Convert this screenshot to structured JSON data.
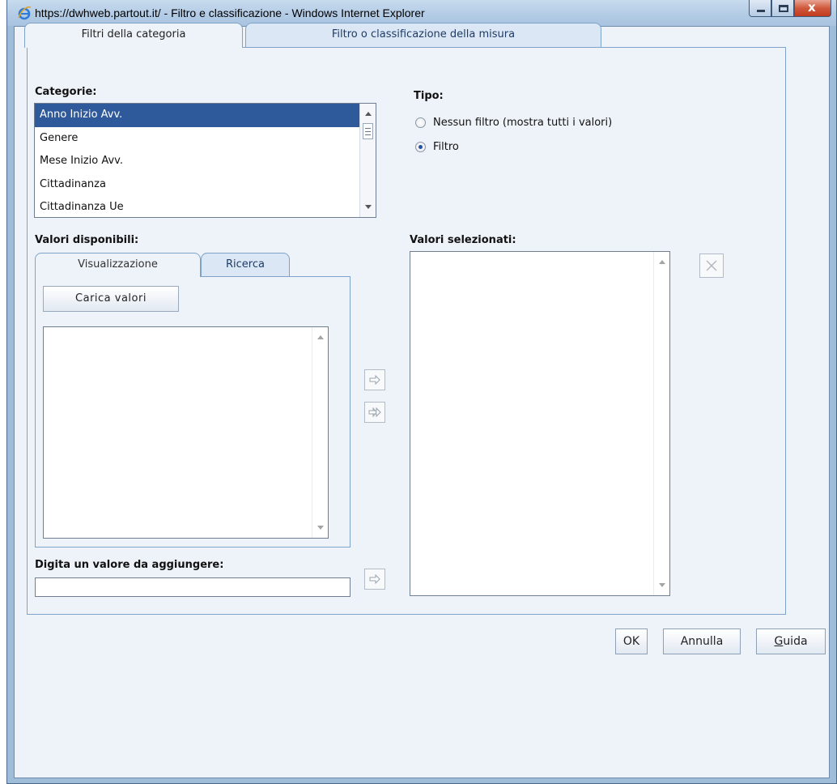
{
  "window": {
    "title": "https://dwhweb.partout.it/ - Filtro e classificazione - Windows Internet Explorer",
    "close_glyph": "x"
  },
  "tabs": [
    {
      "label": "Filtri della categoria",
      "active": true
    },
    {
      "label": "Filtro o classificazione della misura",
      "active": false
    }
  ],
  "categories": {
    "label": "Categorie:",
    "items": [
      {
        "label": "Anno Inizio Avv.",
        "selected": true
      },
      {
        "label": "Genere",
        "selected": false
      },
      {
        "label": "Mese Inizio Avv.",
        "selected": false
      },
      {
        "label": "Cittadinanza",
        "selected": false
      },
      {
        "label": "Cittadinanza Ue",
        "selected": false
      }
    ]
  },
  "type": {
    "label": "Tipo:",
    "options": [
      {
        "label": "Nessun filtro (mostra tutti i valori)",
        "checked": false
      },
      {
        "label": "Filtro",
        "checked": true
      }
    ]
  },
  "available": {
    "label": "Valori disponibili:",
    "tabs": [
      {
        "label": "Visualizzazione",
        "active": true
      },
      {
        "label": "Ricerca",
        "active": false
      }
    ],
    "load_button": "Carica valori",
    "values": []
  },
  "selected": {
    "label": "Valori selezionati:",
    "values": []
  },
  "manual_entry": {
    "label": "Digita un valore da aggiungere:",
    "value": ""
  },
  "buttons": {
    "ok": "OK",
    "cancel": "Annulla",
    "help_mnemonic": "G",
    "help_rest": "uida"
  }
}
